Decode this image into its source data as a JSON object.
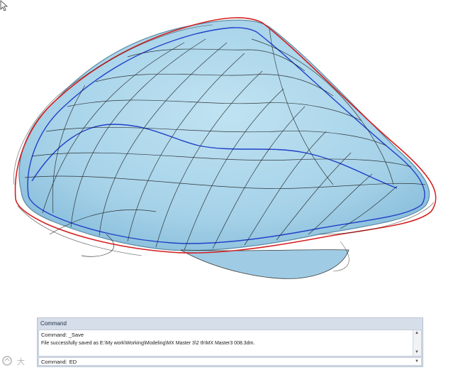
{
  "panel": {
    "title": "Command",
    "history": [
      "Command: _Save",
      "File successfully saved as E:\\My work\\Working\\Modeling\\MX Master 3\\2 th\\MX Master3 008.3dm."
    ],
    "prompt_label": "Command:",
    "input_value": "ED"
  },
  "scrollbar": {
    "up_icon": "chevron-up-icon",
    "down_icon": "chevron-down-icon"
  },
  "watermark": {
    "text": "大"
  },
  "colors": {
    "surface_fill": "#9fd0e8",
    "surface_stroke": "#6aa8c8",
    "wire": "#1a1a1a",
    "curve_red": "#d42020",
    "curve_blue": "#2040c8"
  }
}
